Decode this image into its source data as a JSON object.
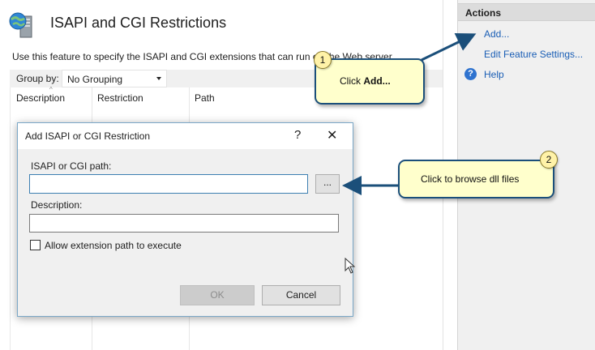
{
  "feature": {
    "title": "ISAPI and CGI Restrictions",
    "description": "Use this feature to specify the ISAPI and CGI extensions that can run on the Web server."
  },
  "groupby": {
    "label": "Group by:",
    "value": "No Grouping"
  },
  "columns": [
    "Description",
    "Restriction",
    "Path"
  ],
  "actions": {
    "header": "Actions",
    "items": [
      "Add...",
      "Edit Feature Settings...",
      "Help"
    ]
  },
  "dialog": {
    "title": "Add ISAPI or CGI Restriction",
    "help_label": "?",
    "close_label": "✕",
    "path_label": "ISAPI or CGI path:",
    "path_value": "",
    "browse_label": "...",
    "description_label": "Description:",
    "description_value": "",
    "checkbox_label": "Allow extension path to execute",
    "checkbox_checked": false,
    "ok_label": "OK",
    "cancel_label": "Cancel"
  },
  "callouts": [
    {
      "number": "1",
      "text_prefix": "Click ",
      "text_bold": "Add..."
    },
    {
      "number": "2",
      "text": "Click to browse dll files"
    }
  ],
  "colors": {
    "link": "#1a5eb5",
    "callout_fill": "#ffffcc",
    "callout_border": "#1b4f7a",
    "arrow": "#1b4f7a"
  }
}
